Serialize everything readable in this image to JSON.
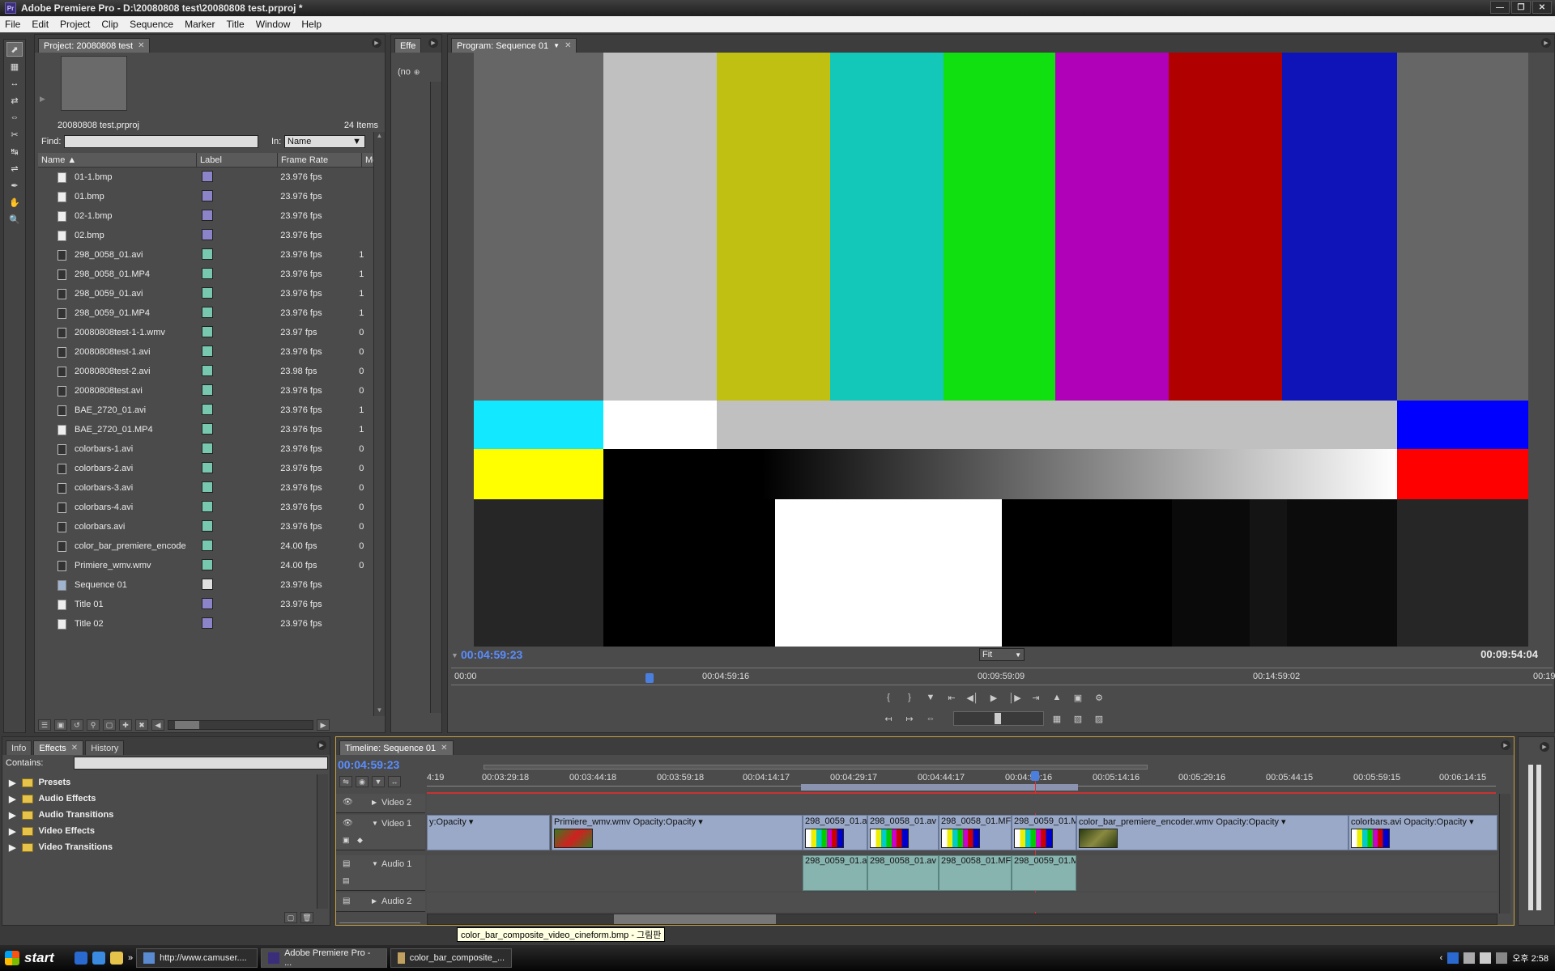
{
  "app": {
    "title": "Adobe Premiere Pro - D:\\20080808 test\\20080808 test.prproj *",
    "logo": "Pr"
  },
  "menu": [
    "File",
    "Edit",
    "Project",
    "Clip",
    "Sequence",
    "Marker",
    "Title",
    "Window",
    "Help"
  ],
  "project": {
    "tab": "Project: 20080808 test",
    "filename": "20080808 test.prproj",
    "item_count": "24 Items",
    "find_label": "Find:",
    "in_label": "In:",
    "in_value": "Name",
    "columns": [
      "Name",
      "Label",
      "Frame Rate",
      "Me"
    ],
    "items": [
      {
        "name": "01-1.bmp",
        "fr": "23.976 fps",
        "m": "",
        "label_color": "#8c84c8",
        "kind": "img"
      },
      {
        "name": "01.bmp",
        "fr": "23.976 fps",
        "m": "",
        "label_color": "#8c84c8",
        "kind": "img"
      },
      {
        "name": "02-1.bmp",
        "fr": "23.976 fps",
        "m": "",
        "label_color": "#8c84c8",
        "kind": "img"
      },
      {
        "name": "02.bmp",
        "fr": "23.976 fps",
        "m": "",
        "label_color": "#8c84c8",
        "kind": "img"
      },
      {
        "name": "298_0058_01.avi",
        "fr": "23.976 fps",
        "m": "1",
        "label_color": "#78c8b0",
        "kind": "vid"
      },
      {
        "name": "298_0058_01.MP4",
        "fr": "23.976 fps",
        "m": "1",
        "label_color": "#78c8b0",
        "kind": "vid"
      },
      {
        "name": "298_0059_01.avi",
        "fr": "23.976 fps",
        "m": "1",
        "label_color": "#78c8b0",
        "kind": "vid"
      },
      {
        "name": "298_0059_01.MP4",
        "fr": "23.976 fps",
        "m": "1",
        "label_color": "#78c8b0",
        "kind": "vid"
      },
      {
        "name": "20080808test-1-1.wmv",
        "fr": "23.97 fps",
        "m": "0",
        "label_color": "#78c8b0",
        "kind": "vid"
      },
      {
        "name": "20080808test-1.avi",
        "fr": "23.976 fps",
        "m": "0",
        "label_color": "#78c8b0",
        "kind": "vid"
      },
      {
        "name": "20080808test-2.avi",
        "fr": "23.98 fps",
        "m": "0",
        "label_color": "#78c8b0",
        "kind": "vid"
      },
      {
        "name": "20080808test.avi",
        "fr": "23.976 fps",
        "m": "0",
        "label_color": "#78c8b0",
        "kind": "vid"
      },
      {
        "name": "BAE_2720_01.avi",
        "fr": "23.976 fps",
        "m": "1",
        "label_color": "#78c8b0",
        "kind": "vid"
      },
      {
        "name": "BAE_2720_01.MP4",
        "fr": "23.976 fps",
        "m": "1",
        "label_color": "#78c8b0",
        "kind": "img"
      },
      {
        "name": "colorbars-1.avi",
        "fr": "23.976 fps",
        "m": "0",
        "label_color": "#78c8b0",
        "kind": "vid"
      },
      {
        "name": "colorbars-2.avi",
        "fr": "23.976 fps",
        "m": "0",
        "label_color": "#78c8b0",
        "kind": "vid"
      },
      {
        "name": "colorbars-3.avi",
        "fr": "23.976 fps",
        "m": "0",
        "label_color": "#78c8b0",
        "kind": "vid"
      },
      {
        "name": "colorbars-4.avi",
        "fr": "23.976 fps",
        "m": "0",
        "label_color": "#78c8b0",
        "kind": "vid"
      },
      {
        "name": "colorbars.avi",
        "fr": "23.976 fps",
        "m": "0",
        "label_color": "#78c8b0",
        "kind": "vid"
      },
      {
        "name": "color_bar_premiere_encode",
        "fr": "24.00 fps",
        "m": "0",
        "label_color": "#78c8b0",
        "kind": "vid"
      },
      {
        "name": "Primiere_wmv.wmv",
        "fr": "24.00 fps",
        "m": "0",
        "label_color": "#78c8b0",
        "kind": "vid"
      },
      {
        "name": "Sequence 01",
        "fr": "23.976 fps",
        "m": "",
        "label_color": "#e0e0e0",
        "kind": "seq"
      },
      {
        "name": "Title 01",
        "fr": "23.976 fps",
        "m": "",
        "label_color": "#8c84c8",
        "kind": "img"
      },
      {
        "name": "Title 02",
        "fr": "23.976 fps",
        "m": "",
        "label_color": "#8c84c8",
        "kind": "img"
      }
    ]
  },
  "effects_small": {
    "tab": "Effe",
    "dropdown": "(no"
  },
  "program": {
    "tab": "Program: Sequence 01",
    "current_tc": "00:04:59:23",
    "duration_tc": "00:09:54:04",
    "fit": "Fit",
    "ruler": [
      "00:00",
      "00:04:59:16",
      "00:09:59:09",
      "00:14:59:02",
      "00:19"
    ],
    "playhead_fraction": 0.18
  },
  "bottom_left": {
    "tabs": [
      "Info",
      "Effects",
      "History"
    ],
    "contains_label": "Contains:",
    "folders": [
      "Presets",
      "Audio Effects",
      "Audio Transitions",
      "Video Effects",
      "Video Transitions"
    ]
  },
  "timeline": {
    "tab": "Timeline: Sequence 01",
    "current_tc": "00:04:59:23",
    "ruler": [
      "4:19",
      "00:03:29:18",
      "00:03:44:18",
      "00:03:59:18",
      "00:04:14:17",
      "00:04:29:17",
      "00:04:44:17",
      "00:04:59:16",
      "00:05:14:16",
      "00:05:29:16",
      "00:05:44:15",
      "00:05:59:15",
      "00:06:14:15"
    ],
    "tracks": {
      "video2": "Video 2",
      "video1": "Video 1",
      "audio1": "Audio 1",
      "audio2": "Audio 2"
    },
    "video_clips": [
      {
        "label": "y:Opacity ▾"
      },
      {
        "label": "Primiere_wmv.wmv  Opacity:Opacity ▾"
      },
      {
        "label": "298_0059_01.a"
      },
      {
        "label": "298_0058_01.av"
      },
      {
        "label": "298_0058_01.MF"
      },
      {
        "label": "298_0059_01.M"
      },
      {
        "label": "color_bar_premiere_encoder.wmv  Opacity:Opacity ▾"
      },
      {
        "label": "colorbars.avi  Opacity:Opacity ▾"
      }
    ],
    "audio_clips": [
      {
        "label": "298_0059_01.a"
      },
      {
        "label": "298_0058_01.av"
      },
      {
        "label": "298_0058_01.MF"
      },
      {
        "label": "298_0059_01.M"
      }
    ]
  },
  "tooltip": "color_bar_composite_video_cineform.bmp - 그림판",
  "taskbar": {
    "start": "start",
    "tasks": [
      "http://www.camuser....",
      "Adobe Premiere Pro - ...",
      "color_bar_composite_..."
    ],
    "clock": "오후 2:58"
  }
}
